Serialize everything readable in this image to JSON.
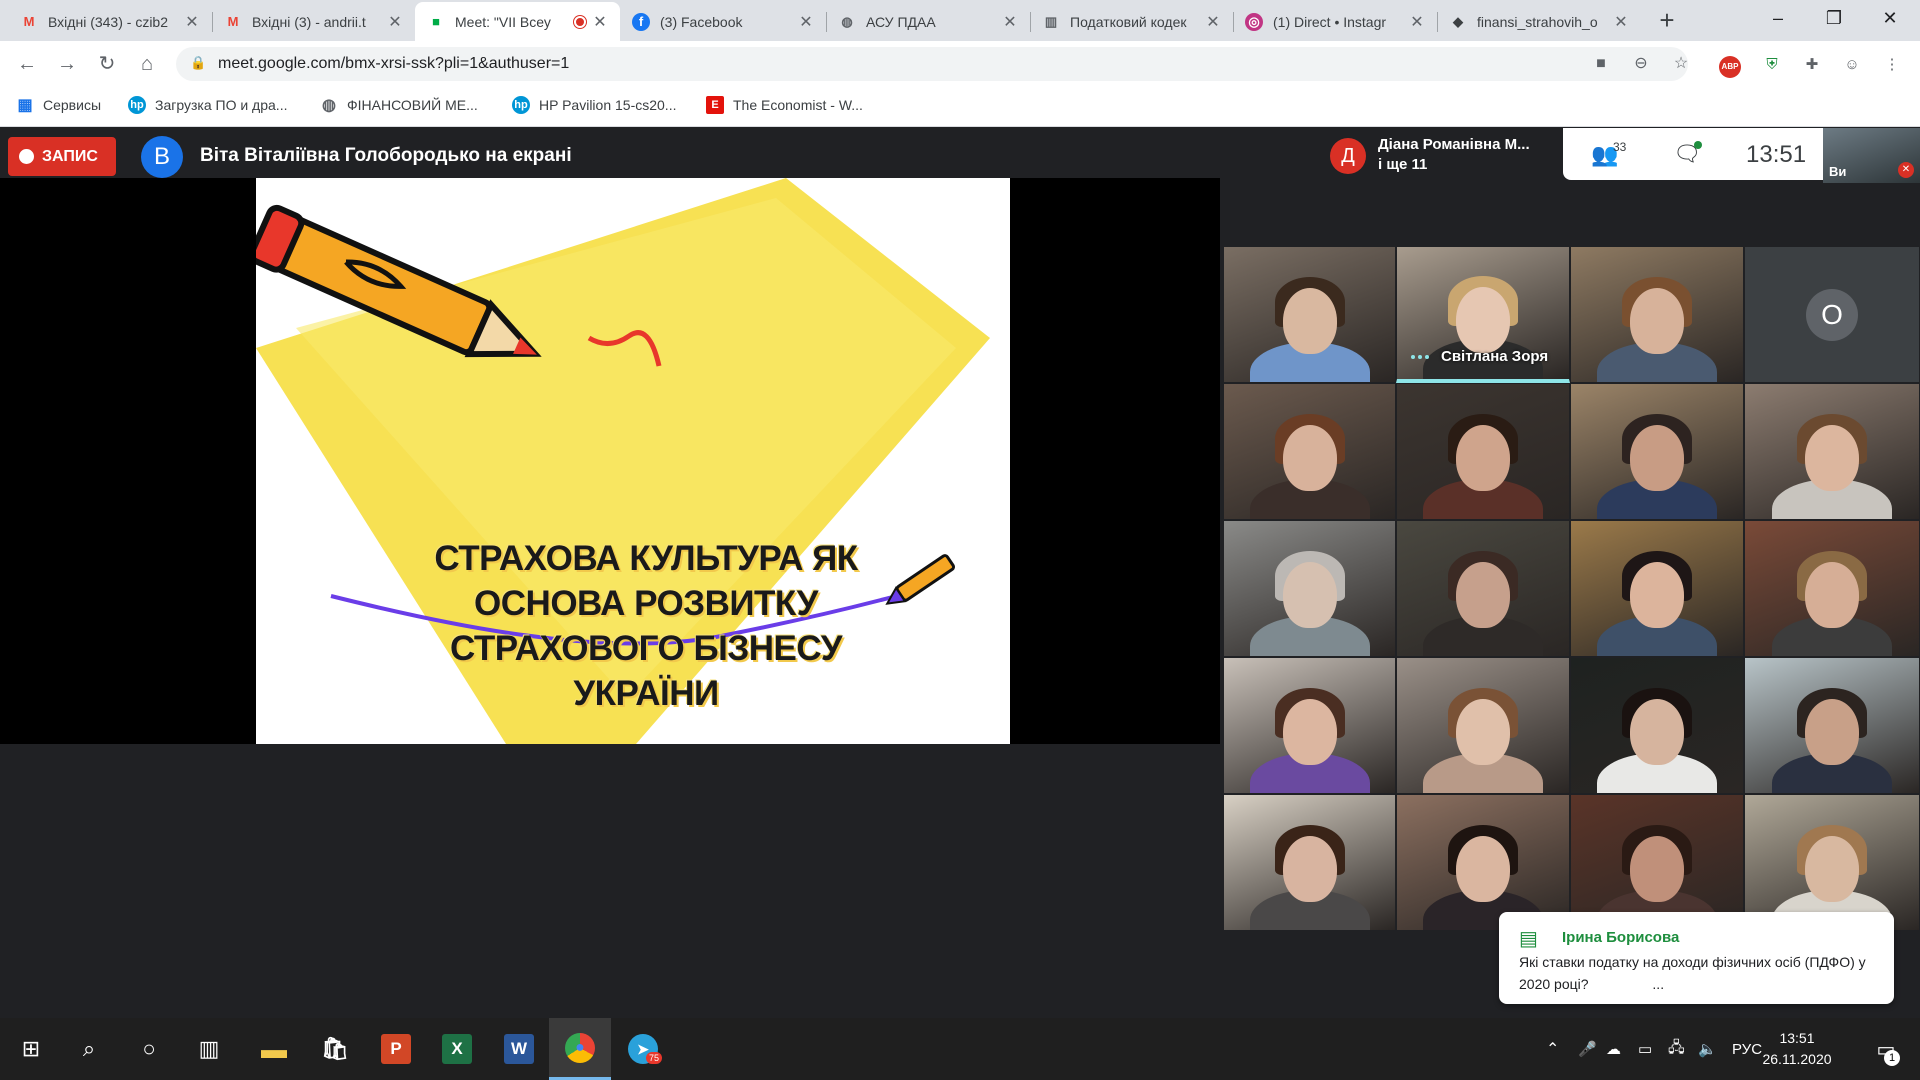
{
  "browser": {
    "tabs": [
      {
        "title": "Вхідні (343) - czib2",
        "icon": "gmail-icon",
        "active": false
      },
      {
        "title": "Вхідні (3) - andrii.t",
        "icon": "gmail-icon",
        "active": false
      },
      {
        "title": "Meet: \"VII Всеу",
        "icon": "meet-icon",
        "active": true,
        "recording": true
      },
      {
        "title": "(3) Facebook",
        "icon": "facebook-icon",
        "active": false
      },
      {
        "title": "АСУ ПДАА",
        "icon": "globe-icon",
        "active": false
      },
      {
        "title": "Податковий кодек",
        "icon": "gov-icon",
        "active": false
      },
      {
        "title": "(1) Direct • Instagr",
        "icon": "instagram-icon",
        "active": false
      },
      {
        "title": "finansi_strahovih_o",
        "icon": "doc-icon",
        "active": false
      }
    ],
    "url": "meet.google.com/bmx-xrsi-ssk?pli=1&authuser=1",
    "bookmarks": [
      {
        "label": "Сервисы",
        "icon": "apps-grid-icon"
      },
      {
        "label": "Загрузка ПО и дра...",
        "icon": "hp-icon"
      },
      {
        "label": "ФІНАНСОВИЙ МЕ...",
        "icon": "globe-icon"
      },
      {
        "label": "HP Pavilion 15-cs20...",
        "icon": "hp-icon"
      },
      {
        "label": "The Economist - W...",
        "icon": "economist-icon"
      }
    ],
    "extensions": [
      "ABP",
      "shield-extension-icon",
      "puzzle-icon",
      "profile-icon"
    ]
  },
  "meet": {
    "record_label": "ЗАПИС",
    "presenter_initial": "В",
    "presenter_text": "Віта Віталіївна Голобородько на екрані",
    "notice": {
      "initial": "Д",
      "line1": "Діана Романівна М...",
      "line2": "і ще 11"
    },
    "participants_count": "33",
    "time": "13:51",
    "self_label": "Ви",
    "slide_title": [
      "СТРАХОВА КУЛЬТУРА ЯК",
      "ОСНОВА РОЗВИТКУ",
      "СТРАХОВОГО БІЗНЕСУ",
      "УКРАЇНИ"
    ],
    "grid": [
      {
        "bg": "#7a6e63",
        "face": "#d9b8a0",
        "hair": "#3b2a1e",
        "shirt": "#6f95c9"
      },
      {
        "bg": "#a89c8e",
        "face": "#e6c7b2",
        "hair": "#c9a670",
        "shirt": "#2b2b2b",
        "name": "Світлана Зоря",
        "speaking": true
      },
      {
        "bg": "#8e7a62",
        "face": "#d7b29a",
        "hair": "#7a5030",
        "shirt": "#4a5a70"
      },
      {
        "avatar": "O"
      },
      {
        "bg": "#6b5a4e",
        "face": "#d8b29b",
        "hair": "#6a3d25",
        "shirt": "#3a2e2a"
      },
      {
        "bg": "#3c3530",
        "face": "#cfa48c",
        "hair": "#2a1c14",
        "shirt": "#5a3028"
      },
      {
        "bg": "#9b8468",
        "face": "#c89c84",
        "hair": "#2d2320",
        "shirt": "#2c3b5c"
      },
      {
        "bg": "#8c7c70",
        "face": "#dcb69e",
        "hair": "#6b4a30",
        "shirt": "#c8c4be"
      },
      {
        "bg": "#8a8a88",
        "face": "#d6c0b0",
        "hair": "#bcb8b4",
        "shirt": "#7e8a90"
      },
      {
        "bg": "#4a4840",
        "face": "#c6a08c",
        "hair": "#3b2a24",
        "shirt": "#2e2a28"
      },
      {
        "bg": "#9b7a4a",
        "face": "#dcb49c",
        "hair": "#1e1616",
        "shirt": "#3e5068"
      },
      {
        "bg": "#7a4a38",
        "face": "#d6ae96",
        "hair": "#8a6a44",
        "shirt": "#3c3c3c"
      },
      {
        "bg": "#c8c0b8",
        "face": "#dcb6a0",
        "hair": "#4a2e22",
        "shirt": "#6a4aa0"
      },
      {
        "bg": "#9a9088",
        "face": "#e0c0aa",
        "hair": "#7a5236",
        "shirt": "#b89a88"
      },
      {
        "bg": "#1e2220",
        "face": "#d6b49e",
        "hair": "#1a1210",
        "shirt": "#e8e8e6"
      },
      {
        "bg": "#b8c4c8",
        "face": "#c8a088",
        "hair": "#2c2420",
        "shirt": "#2a3040"
      },
      {
        "bg": "#d8d0c4",
        "face": "#d8b4a0",
        "hair": "#3a2418",
        "shirt": "#4a4848"
      },
      {
        "bg": "#8c7060",
        "face": "#dab6a0",
        "hair": "#1e1410",
        "shirt": "#2a2428"
      },
      {
        "bg": "#5a3428",
        "face": "#c0907a",
        "hair": "#2a1a14",
        "shirt": "#4a3430"
      },
      {
        "bg": "#b0a898",
        "face": "#d8b8a0",
        "hair": "#a07850",
        "shirt": "#d8d4cc"
      }
    ],
    "chat_toast": {
      "from": "Ірина Борисова",
      "message": "Які ставки податку на доходи фізичних осіб (ПДФО) у 2020 році?",
      "more": "..."
    }
  },
  "taskbar": {
    "apps": [
      {
        "name": "file-explorer",
        "color": "#f2c94c",
        "glyph": "▬"
      },
      {
        "name": "store",
        "color": "#ffffff",
        "glyph": "🛍"
      },
      {
        "name": "powerpoint",
        "color": "#d24726",
        "glyph": "P"
      },
      {
        "name": "excel",
        "color": "#1e7145",
        "glyph": "X"
      },
      {
        "name": "word",
        "color": "#2b579a",
        "glyph": "W"
      },
      {
        "name": "chrome",
        "color": "#4285f4",
        "glyph": "●"
      },
      {
        "name": "telegram",
        "color": "#2aa1da",
        "glyph": "➤"
      }
    ],
    "language": "РУС",
    "time": "13:51",
    "date": "26.11.2020",
    "notification_count": "1",
    "telegram_badge": "75"
  }
}
